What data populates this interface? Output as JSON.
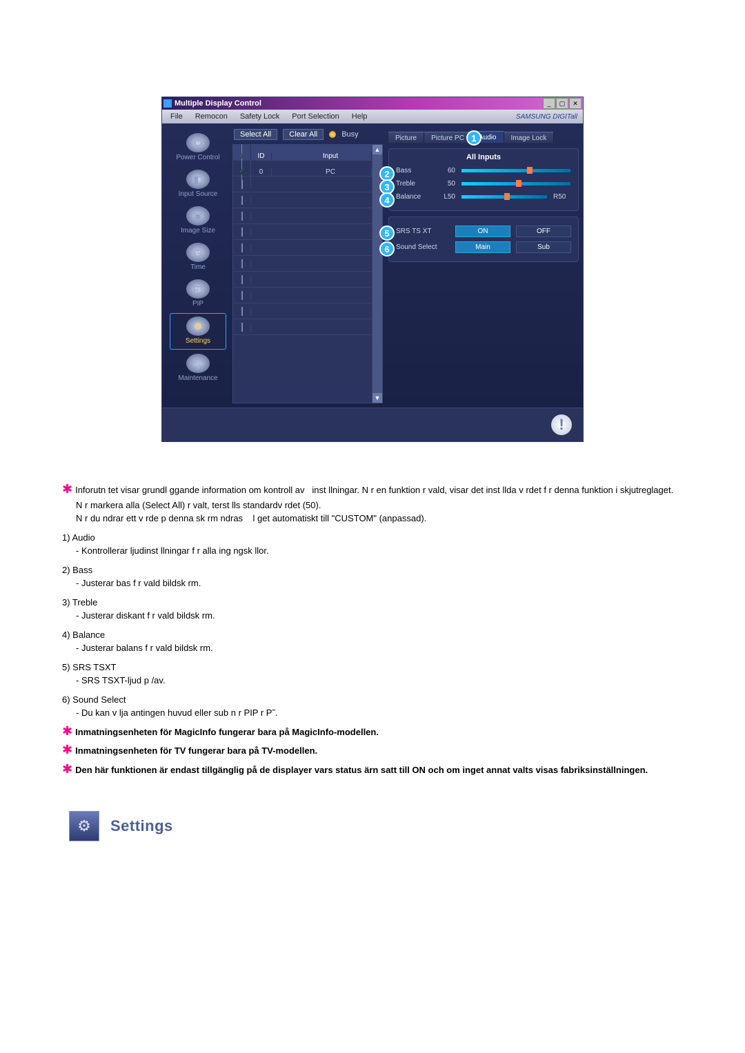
{
  "window": {
    "title": "Multiple Display Control",
    "brand": "SAMSUNG DIGITall"
  },
  "menubar": [
    "File",
    "Remocon",
    "Safety Lock",
    "Port Selection",
    "Help"
  ],
  "toolbar": {
    "select_all": "Select All",
    "clear_all": "Clear All",
    "busy": "Busy"
  },
  "sidebar": [
    {
      "id": "power-control",
      "label": "Power Control"
    },
    {
      "id": "input-source",
      "label": "Input Source"
    },
    {
      "id": "image-size",
      "label": "Image Size"
    },
    {
      "id": "time",
      "label": "Time"
    },
    {
      "id": "pip",
      "label": "PIP"
    },
    {
      "id": "settings",
      "label": "Settings",
      "selected": true
    },
    {
      "id": "maintenance",
      "label": "Maintenance"
    }
  ],
  "grid": {
    "head": {
      "col_id": "ID",
      "col_input": "Input"
    },
    "rows": [
      {
        "checked": true,
        "id": "0",
        "status": true,
        "input": "PC"
      }
    ],
    "blank_rows": 10
  },
  "tabs": [
    "Picture",
    "Picture PC",
    "Audio",
    "Image Lock"
  ],
  "active_tab": 2,
  "audio_panel": {
    "all_inputs": "All Inputs",
    "bass": {
      "label": "Bass",
      "value": "60",
      "thumb_pct": 60
    },
    "treble": {
      "label": "Treble",
      "value": "50",
      "thumb_pct": 50
    },
    "balance": {
      "label": "Balance",
      "left": "L50",
      "right": "R50",
      "thumb_pct": 50
    },
    "srs": {
      "label": "SRS TS XT",
      "on": "ON",
      "off": "OFF"
    },
    "sound_select": {
      "label": "Sound Select",
      "main": "Main",
      "sub": "Sub"
    }
  },
  "body": {
    "note1_a": "Inforutn tet visar grundl ggande information om kontroll av",
    "note1_b": "inst llningar. N r en funktion r vald, visar det inst llda v rdet f r denna funktion i skjutreglaget.",
    "note1_c": "N r markera alla (Select All) r valt, terst lls standardv rdet (50).",
    "note1_d": "N r du ndrar ett v rde p denna sk rm ndras",
    "note1_e": "l get automatiskt till \"CUSTOM\" (anpassad).",
    "i1_t": "1) Audio",
    "i1_d": "- Kontrollerar ljudinst llningar f r alla ing ngsk llor.",
    "i2_t": "2) Bass",
    "i2_d": "- Justerar bas f r vald bildsk rm.",
    "i3_t": "3) Treble",
    "i3_d": "- Justerar diskant f r vald bildsk rm.",
    "i4_t": "4) Balance",
    "i4_d": "- Justerar balans f r vald bildsk rm.",
    "i5_t": "5) SRS TSXT",
    "i5_d": "- SRS TSXT-ljud p /av.",
    "i6_t": "6) Sound Select",
    "i6_d": "- Du kan v lja antingen huvud eller sub n r PIP r P˜.",
    "note2": "Inmatningsenheten för MagicInfo fungerar bara på MagicInfo-modellen.",
    "note3": "Inmatningsenheten för TV fungerar bara på TV-modellen.",
    "note4": "Den här funktionen är endast tillgänglig på de displayer vars status ärn satt till ON och om inget annat valts visas fabriksinställningen."
  },
  "section_title": "Settings"
}
